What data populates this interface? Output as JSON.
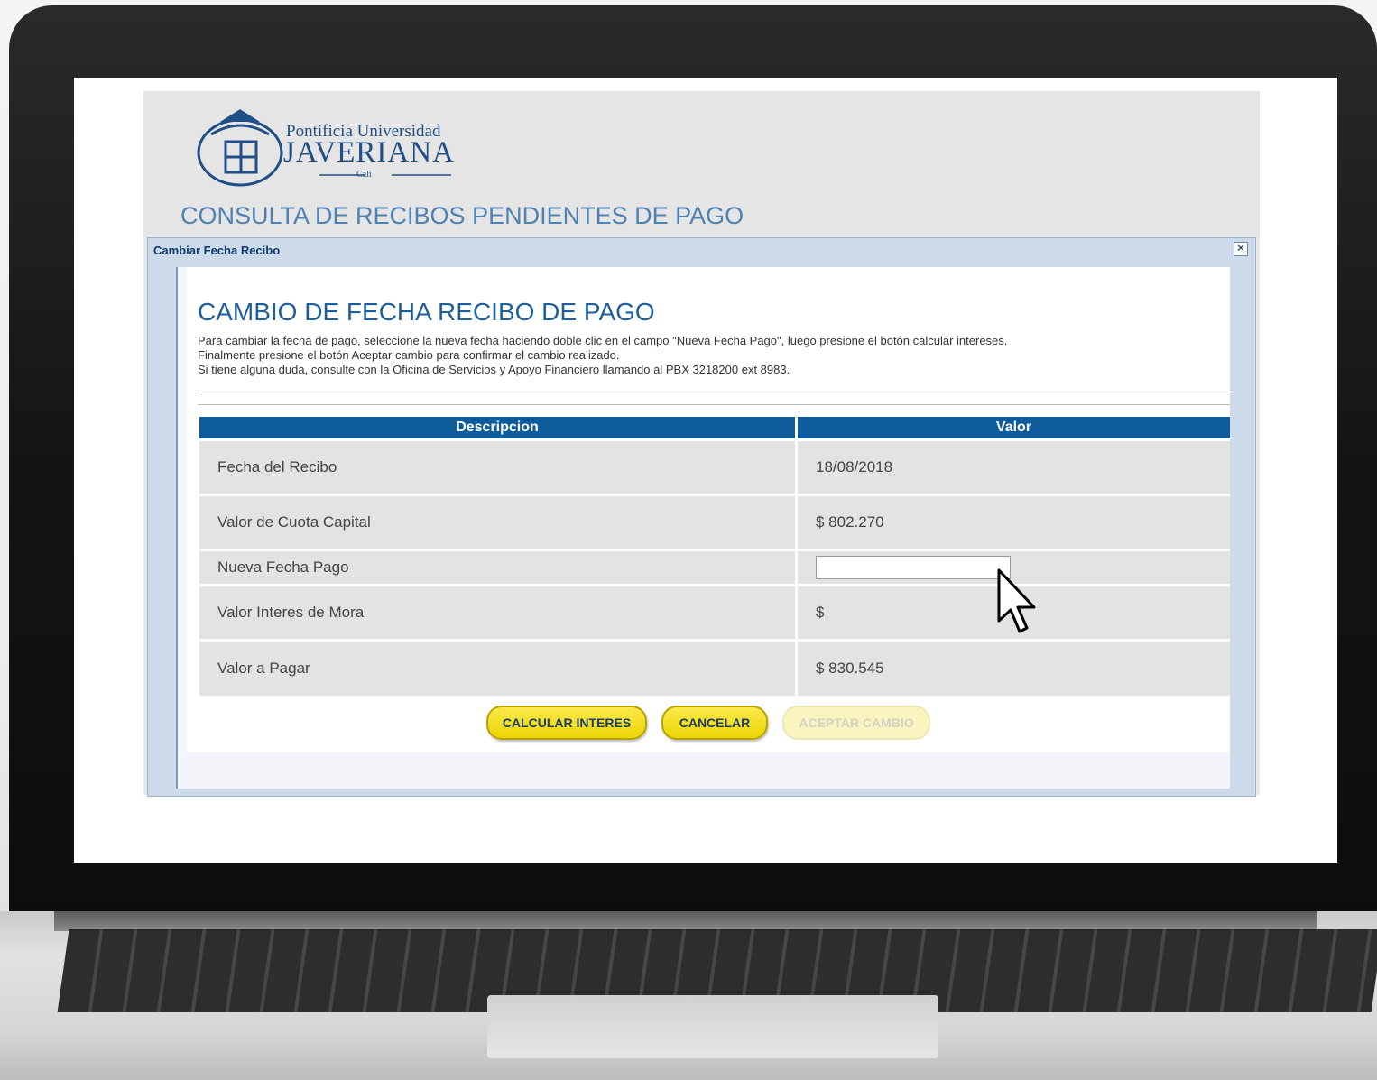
{
  "header": {
    "university_line1": "Pontificia Universidad",
    "university_line2": "JAVERIANA",
    "university_line3": "Cali",
    "page_title": "CONSULTA DE RECIBOS PENDIENTES DE PAGO"
  },
  "dialog": {
    "title": "Cambiar Fecha Recibo",
    "close_symbol": "✕",
    "heading": "CAMBIO DE FECHA RECIBO DE PAGO",
    "intro_lines": [
      "Para cambiar la fecha de pago, seleccione la nueva fecha haciendo doble clic en el campo \"Nueva Fecha Pago\", luego presione el botón calcular intereses.",
      "Finalmente presione el botón Aceptar cambio para confirmar el cambio realizado.",
      "Si tiene alguna duda, consulte con la Oficina de Servicios y Apoyo Financiero llamando al PBX 3218200 ext 8983."
    ],
    "table": {
      "headers": [
        "Descripcion",
        "Valor"
      ],
      "rows": [
        {
          "label": "Fecha del Recibo",
          "value": "18/08/2018"
        },
        {
          "label": "Valor de Cuota Capital",
          "value": "$ 802.270"
        },
        {
          "label": "Nueva Fecha Pago",
          "value": ""
        },
        {
          "label": "Valor Interes de Mora",
          "value": "$"
        },
        {
          "label": "Valor a Pagar",
          "value": "$ 830.545"
        }
      ]
    },
    "buttons": {
      "calcular": "CALCULAR INTERES",
      "cancelar": "CANCELAR",
      "aceptar": "ACEPTAR CAMBIO"
    }
  },
  "colors": {
    "header_bar": "#0f5c9d",
    "button_yellow": "#f3df2a",
    "title_blue": "#1d5f9c"
  },
  "icons": [
    "university-crest-icon",
    "close-icon",
    "mouse-pointer-icon"
  ]
}
